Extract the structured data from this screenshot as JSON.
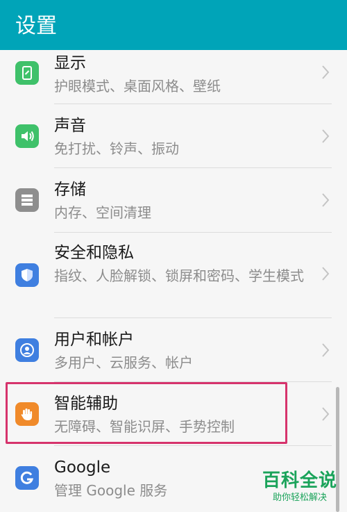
{
  "header": {
    "title": "设置"
  },
  "items": [
    {
      "title": "显示",
      "subtitle": "护眼模式、桌面风格、壁纸",
      "icon": "display-icon",
      "color": "#3fc16a"
    },
    {
      "title": "声音",
      "subtitle": "免打扰、铃声、振动",
      "icon": "sound-icon",
      "color": "#3fc16a"
    },
    {
      "title": "存储",
      "subtitle": "内存、空间清理",
      "icon": "storage-icon",
      "color": "#8e8e8e"
    },
    {
      "title": "安全和隐私",
      "subtitle": "指纹、人脸解锁、锁屏和密码、学生模式",
      "icon": "shield-icon",
      "color": "#3f7fe0"
    },
    {
      "title": "用户和帐户",
      "subtitle": "多用户、云服务、帐户",
      "icon": "user-icon",
      "color": "#3f7fe0"
    },
    {
      "title": "智能辅助",
      "subtitle": "无障碍、智能识屏、手势控制",
      "icon": "hand-icon",
      "color": "#f08a2a"
    },
    {
      "title": "Google",
      "subtitle": "管理 Google 服务",
      "icon": "google-icon",
      "color": "#3f7fe0"
    }
  ],
  "watermark": {
    "main": "百科全说",
    "sub": "助你轻松解决"
  }
}
